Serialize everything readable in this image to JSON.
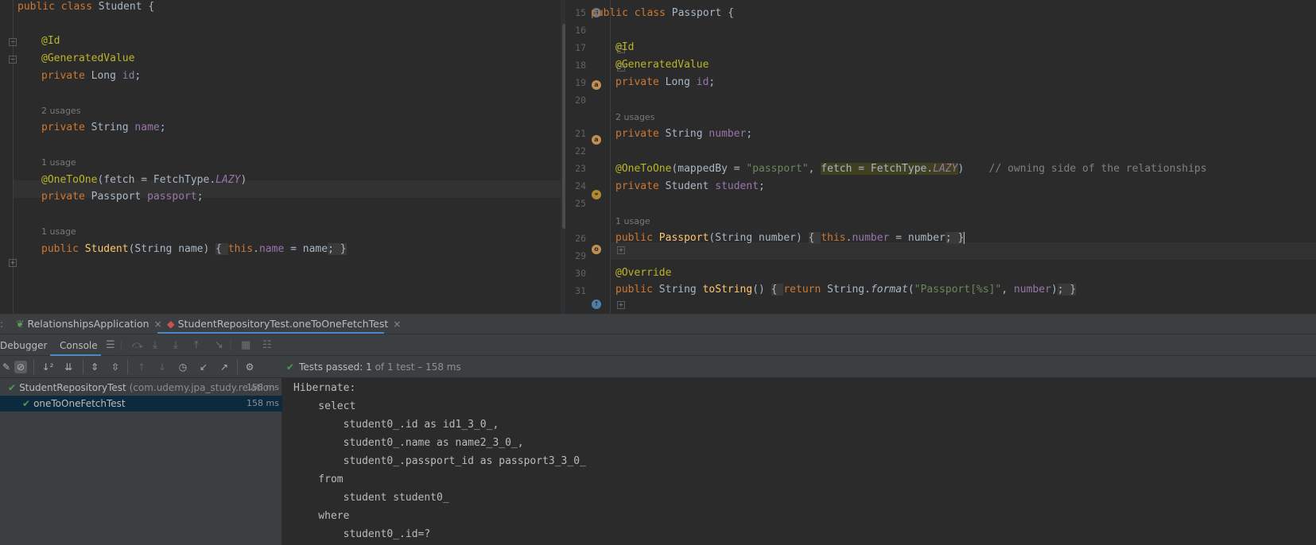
{
  "left_editor": {
    "lines": [
      {
        "kind": "code",
        "html": "<span class='kw'>public class </span>Student {"
      },
      {
        "kind": "code",
        "html": "<span class='an'>@Id</span>"
      },
      {
        "kind": "code",
        "html": "<span class='an'>@GeneratedValue</span>"
      },
      {
        "kind": "code",
        "html": "<span class='kw'>private </span>Long <span class='fd'>id</span>;"
      },
      {
        "kind": "hint",
        "text": "2 usages"
      },
      {
        "kind": "code",
        "html": "<span class='kw'>private </span>String <span class='fd'>name</span>;"
      },
      {
        "kind": "hint",
        "text": "1 usage"
      },
      {
        "kind": "code",
        "html": "<span class='an'>@OneToOne</span>(fetch = FetchType.<span class='fd it'>LAZY</span>)"
      },
      {
        "kind": "code",
        "html": "<span class='kw'>private </span>Passport <span class='fd'>passport</span>;"
      },
      {
        "kind": "hint",
        "text": "1 usage"
      },
      {
        "kind": "code",
        "html": "<span class='kw'>public </span><span class='fn'>Student</span>(String name) <span class='fold-hl'>{ </span><span class='kw'>this</span>.<span class='fd'>name</span> = name<span class='fold-hl'>; }</span>"
      }
    ]
  },
  "right_editor": {
    "line_numbers": [
      "15",
      "16",
      "17",
      "18",
      "19",
      "20",
      "21",
      "22",
      "23",
      "24",
      "25",
      "26",
      "29",
      "30",
      "31"
    ],
    "lines": [
      {
        "kind": "code",
        "html": "<span class='kw'>public class </span>Passport {"
      },
      {
        "kind": "code",
        "html": "<span class='an'>@Id</span>"
      },
      {
        "kind": "code",
        "html": "<span class='an'>@GeneratedValue</span>"
      },
      {
        "kind": "code",
        "html": "<span class='kw'>private </span>Long <span class='fd'>id</span>;"
      },
      {
        "kind": "hint",
        "text": "2 usages"
      },
      {
        "kind": "code",
        "html": "<span class='kw'>private </span>String <span class='fd'>number</span>;"
      },
      {
        "kind": "code",
        "html": "<span class='an'>@OneToOne</span>(mappedBy = <span class='st'>\"passport\"</span>, <span class='sel-hl'>fetch = FetchType.<span class='fd it'>LAZY</span></span>)    <span class='cm'>// owning side of the relationships</span>"
      },
      {
        "kind": "code",
        "html": "<span class='kw'>private </span>Student <span class='fd'>student</span>;"
      },
      {
        "kind": "hint",
        "text": "1 usage"
      },
      {
        "kind": "code",
        "html": "<span class='kw'>public </span><span class='fn'>Passport</span>(String number) <span class='fold-hl'>{ </span><span class='kw'>this</span>.<span class='fd'>number</span> = number<span class='fold-hl'>; }</span><span class='cursor'></span>"
      },
      {
        "kind": "code",
        "html": "<span class='an'>@Override</span>"
      },
      {
        "kind": "code",
        "html": "<span class='kw'>public </span>String <span class='fn'>toString</span>() <span class='fold-hl'>{ </span><span class='kw'>return </span>String.<span class='it'>format</span>(<span class='st'>\"Passport[%s]\"</span>, <span class='fd'>number</span>)<span class='fold-hl'>; }</span>"
      }
    ]
  },
  "run_tabs": [
    {
      "label": "RelationshipsApplication",
      "close": "×"
    },
    {
      "label": "StudentRepositoryTest.oneToOneFetchTest",
      "close": "×"
    }
  ],
  "sub_tabs": {
    "debugger": "Debugger",
    "console": "Console"
  },
  "status": {
    "label": "Tests passed:",
    "count": "1",
    "rest": "of 1 test – 158 ms"
  },
  "test_tree": {
    "root": {
      "name": "StudentRepositoryTest",
      "package": "(com.udemy.jpa_study.relation",
      "duration": "158 ms"
    },
    "child": {
      "name": "oneToOneFetchTest",
      "duration": "158 ms"
    }
  },
  "console": {
    "lines": [
      "Hibernate: ",
      "    select",
      "        student0_.id as id1_3_0_,",
      "        student0_.name as name2_3_0_,",
      "        student0_.passport_id as passport3_3_0_ ",
      "    from",
      "        student student0_ ",
      "    where",
      "        student0_.id=?"
    ]
  },
  "icons": {
    "check": "check-icon",
    "close": "close-icon",
    "settings": "gear-icon"
  },
  "colors": {
    "background": "#2b2b2b",
    "keyword": "#cc7832",
    "annotation": "#bbb529",
    "field": "#9876aa",
    "string": "#6a8759",
    "method": "#ffc66d",
    "success": "#499c54",
    "accent": "#4a88c7"
  }
}
